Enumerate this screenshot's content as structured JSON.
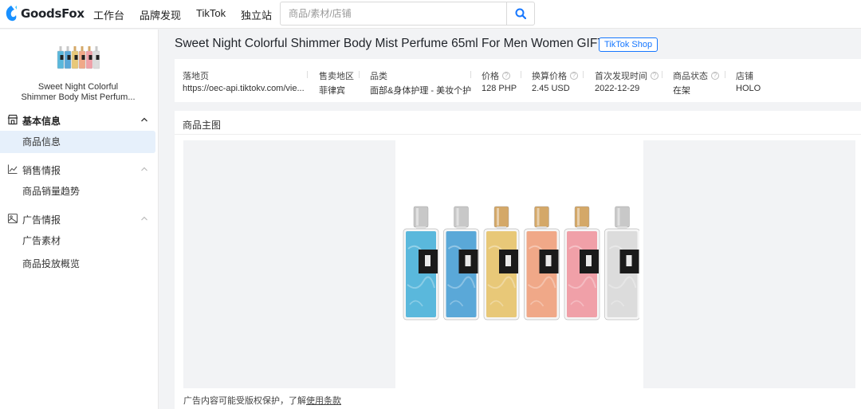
{
  "colors": {
    "accent": "#1677ff",
    "active_bg": "#e6f0fb",
    "page_bg": "#f2f3f5"
  },
  "header": {
    "logo_text": "GoodsFox",
    "nav": [
      "工作台",
      "品牌发现",
      "TikTok",
      "独立站"
    ],
    "search": {
      "placeholder": "商品/素材/店铺",
      "icon": "search-icon"
    }
  },
  "sidebar": {
    "product_name_line1": "Sweet Night Colorful",
    "product_name_line2": "Shimmer Body Mist Perfum...",
    "sections": [
      {
        "label": "基本信息",
        "icon": "shop-icon",
        "expanded": true,
        "items": [
          "商品信息"
        ]
      },
      {
        "label": "销售情报",
        "icon": "line-chart-icon",
        "expanded": true,
        "items": [
          "商品销量趋势"
        ]
      },
      {
        "label": "广告情报",
        "icon": "image-icon",
        "expanded": true,
        "items": [
          "广告素材",
          "商品投放概览"
        ]
      }
    ],
    "active_item": "商品信息"
  },
  "product": {
    "title": "Sweet Night Colorful Shimmer Body Mist Perfume 65ml For Men Women GIFT",
    "badge": "TikTok Shop",
    "info": {
      "landing_label": "落地页",
      "landing_value": "https://oec-api.tiktokv.com/vie...",
      "region_label": "售卖地区",
      "region_value": "菲律宾",
      "category_label": "品类",
      "category_value": "面部&身体护理 - 美妆个护",
      "price_label": "价格",
      "price_value": "128 PHP",
      "converted_label": "换算价格",
      "converted_value": "2.45 USD",
      "first_seen_label": "首次发现时间",
      "first_seen_value": "2022-12-29",
      "status_label": "商品状态",
      "status_value": "在架",
      "store_label": "店铺",
      "store_value": "HOLO"
    }
  },
  "main_image": {
    "section_title": "商品主图",
    "bottle_colors": [
      "#5ab8dc",
      "#5aa8d8",
      "#e8c878",
      "#f0a888",
      "#f0a0a8",
      "#dcdcdc"
    ],
    "cap_colors": [
      "#c8c8c8",
      "#c8c8c8",
      "#d4a868",
      "#d4a868",
      "#d4a868",
      "#c8c8c8"
    ],
    "copyright_text": "广告内容可能受版权保护，了解",
    "copyright_link": "使用条款"
  }
}
